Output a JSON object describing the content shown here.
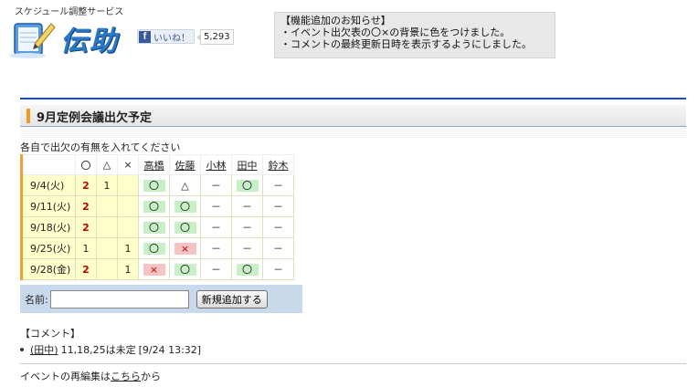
{
  "header": {
    "service_name": "スケジュール調整サービス",
    "logo_text": "伝助",
    "facebook": {
      "like_label": "いいね！",
      "count": "5,293"
    }
  },
  "notice": {
    "title": "【機能追加のお知らせ】",
    "lines": [
      "・イベント出欠表の〇×の背景に色をつけました。",
      "・コメントの最終更新日時を表示するようにしました。"
    ]
  },
  "event": {
    "title": "9月定例会議出欠予定",
    "instruction": "各自で出欠の有無を入れてください"
  },
  "table": {
    "headers": {
      "ok": "〇",
      "maybe": "△",
      "ng": "×"
    },
    "members": [
      "高橋",
      "佐藤",
      "小林",
      "田中",
      "鈴木"
    ],
    "rows": [
      {
        "date": "9/4(火)",
        "ok": "2",
        "maybe": "1",
        "ng": "",
        "marks": [
          "〇",
          "△",
          "－",
          "〇",
          "－"
        ],
        "types": [
          "ok",
          "mb",
          "na",
          "ok",
          "na"
        ]
      },
      {
        "date": "9/11(火)",
        "ok": "2",
        "maybe": "",
        "ng": "",
        "marks": [
          "〇",
          "〇",
          "－",
          "－",
          "－"
        ],
        "types": [
          "ok",
          "ok",
          "na",
          "na",
          "na"
        ]
      },
      {
        "date": "9/18(火)",
        "ok": "2",
        "maybe": "",
        "ng": "",
        "marks": [
          "〇",
          "〇",
          "－",
          "－",
          "－"
        ],
        "types": [
          "ok",
          "ok",
          "na",
          "na",
          "na"
        ]
      },
      {
        "date": "9/25(火)",
        "ok": "1",
        "maybe": "",
        "ng": "1",
        "marks": [
          "〇",
          "×",
          "－",
          "－",
          "－"
        ],
        "types": [
          "ok",
          "ng",
          "na",
          "na",
          "na"
        ]
      },
      {
        "date": "9/28(金)",
        "ok": "2",
        "maybe": "",
        "ng": "1",
        "marks": [
          "×",
          "〇",
          "－",
          "〇",
          "－"
        ],
        "types": [
          "ng",
          "ok",
          "na",
          "ok",
          "na"
        ]
      }
    ]
  },
  "form": {
    "name_label": "名前:",
    "name_value": "",
    "add_button": "新規追加する"
  },
  "comments": {
    "heading": "【コメント】",
    "items": [
      {
        "author": "田中",
        "text": "11,18,25は未定",
        "timestamp": "[9/24 13:32]"
      }
    ]
  },
  "footer": {
    "edit_prefix": "イベントの再編集は",
    "edit_link": "こちら",
    "edit_suffix": "から"
  },
  "colors": {
    "accent_blue": "#1a48d8",
    "accent_orange": "#f29a1d",
    "ok_bg": "#c7f0c7",
    "ng_bg": "#f7c3c3",
    "date_bg": "#ffffcc",
    "form_bg": "#c9d9ec"
  }
}
